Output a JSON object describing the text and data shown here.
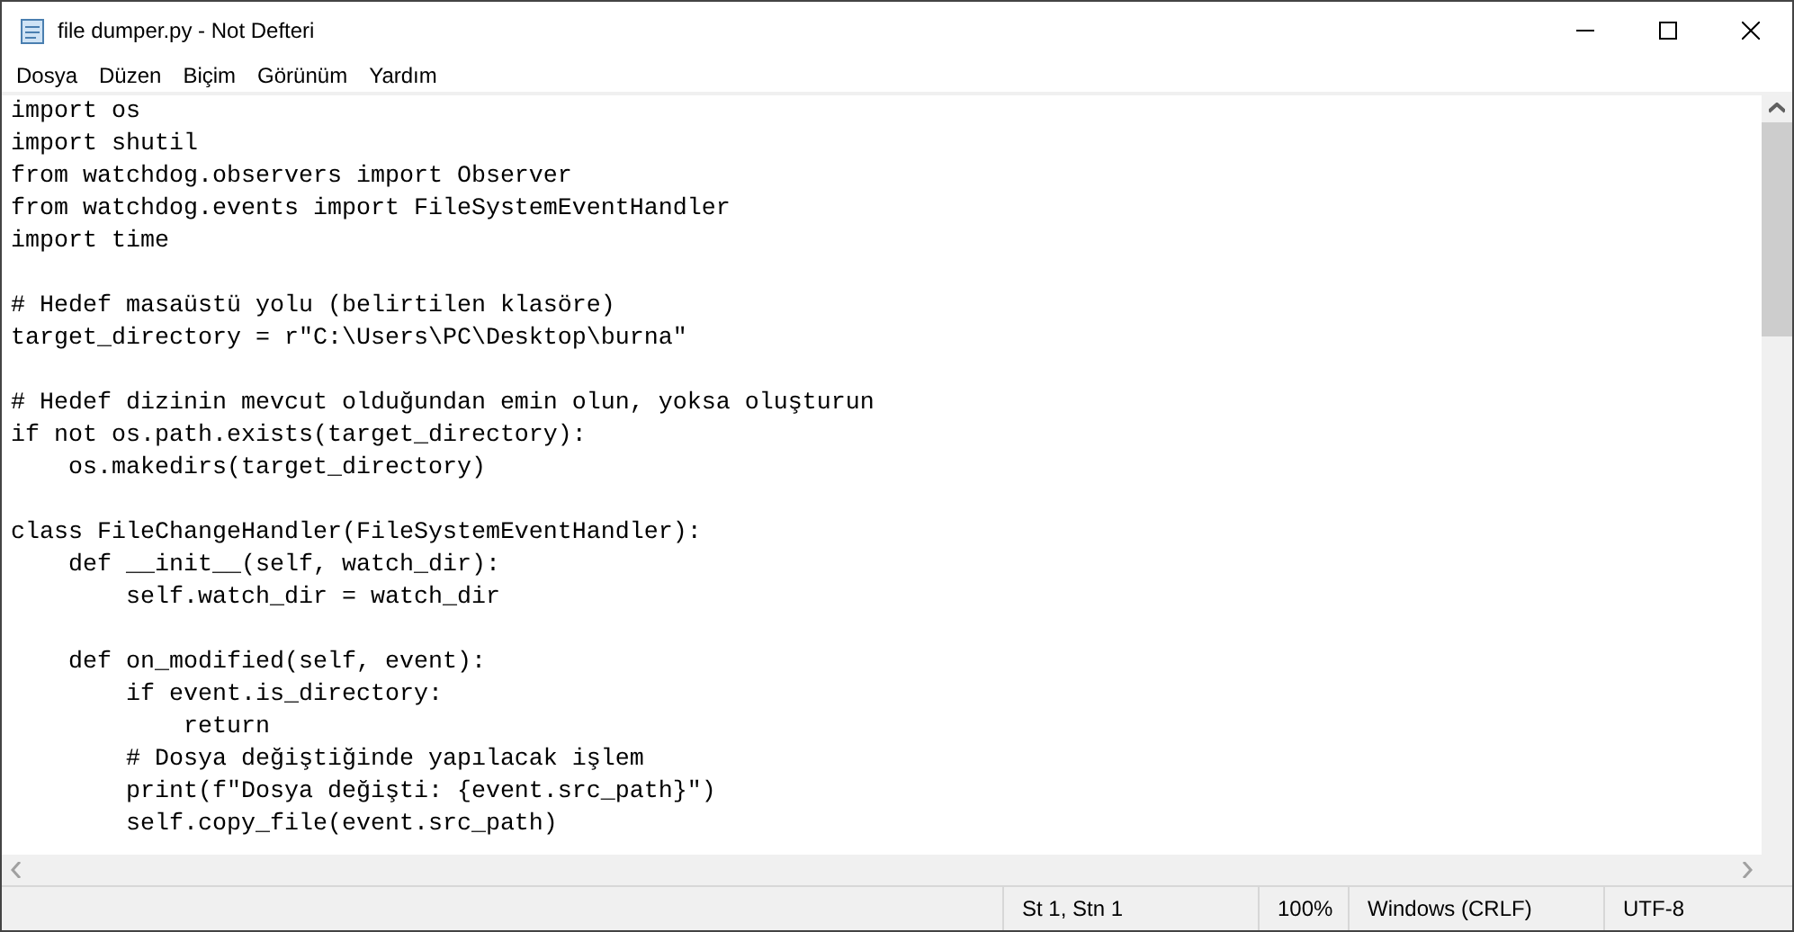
{
  "window": {
    "title": "file dumper.py - Not Defteri"
  },
  "menu": [
    "Dosya",
    "Düzen",
    "Biçim",
    "Görünüm",
    "Yardım"
  ],
  "editor": {
    "blocks": [
      {
        "lines": [
          "import os",
          "import shutil",
          "from watchdog.observers import Observer",
          "from watchdog.events import FileSystemEventHandler",
          "import time"
        ]
      },
      {
        "lines": [
          "# Hedef masaüstü yolu (belirtilen klasöre)",
          "target_directory = r\"C:\\Users\\PC\\Desktop\\burna\""
        ]
      },
      {
        "lines": [
          "# Hedef dizinin mevcut olduğundan emin olun, yoksa oluşturun",
          "if not os.path.exists(target_directory):",
          "    os.makedirs(target_directory)"
        ]
      },
      {
        "lines": [
          "class FileChangeHandler(FileSystemEventHandler):",
          "    def __init__(self, watch_dir):",
          "        self.watch_dir = watch_dir"
        ]
      },
      {
        "lines": [
          "    def on_modified(self, event):",
          "        if event.is_directory:",
          "            return",
          "        # Dosya değiştiğinde yapılacak işlem",
          "        print(f\"Dosya değişti: {event.src_path}\")",
          "        self.copy_file(event.src_path)"
        ]
      }
    ]
  },
  "status_bar": [
    {
      "text": "St 1, Stn 1",
      "kind": "wide"
    },
    {
      "text": "100%",
      "kind": "narrow"
    },
    {
      "text": "Windows (CRLF)",
      "kind": "wide"
    },
    {
      "text": "UTF-8",
      "kind": "last"
    }
  ]
}
